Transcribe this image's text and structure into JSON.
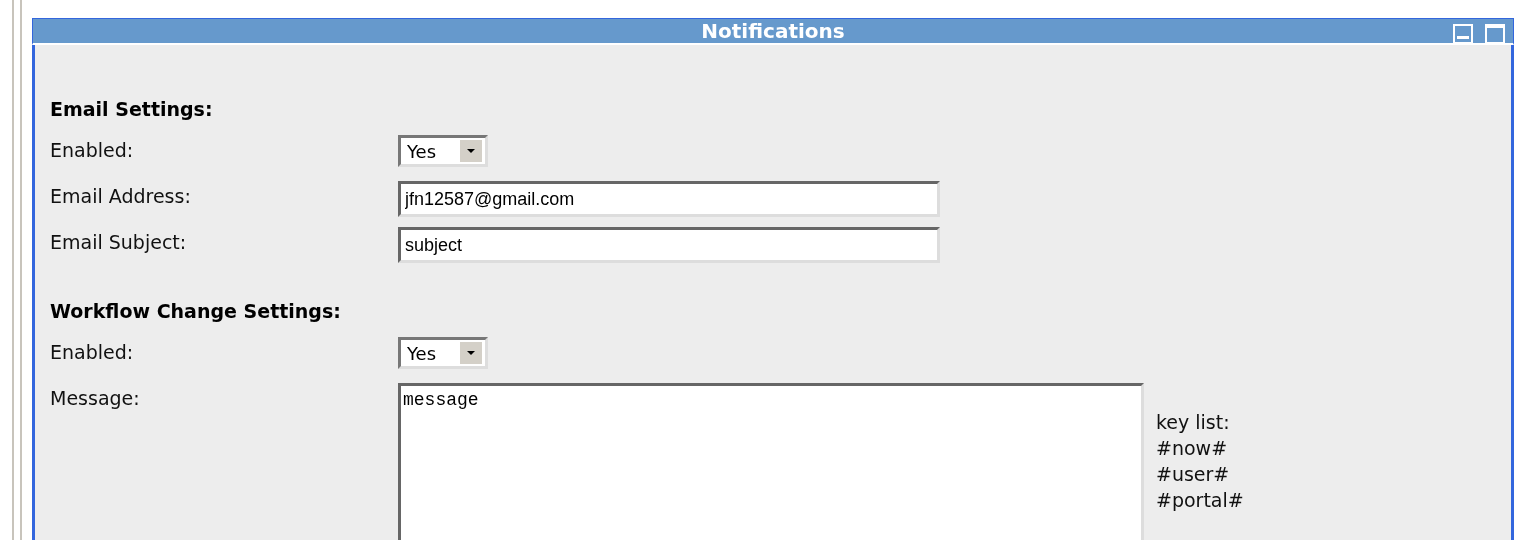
{
  "panel": {
    "title": "Notifications"
  },
  "sections": [
    {
      "heading": "Email Settings:",
      "fields": [
        {
          "kind": "select",
          "label": "Enabled:",
          "value": "Yes"
        },
        {
          "kind": "text",
          "label": "Email Address:",
          "value": "jfn12587@gmail.com"
        },
        {
          "kind": "text",
          "label": "Email Subject:",
          "value": "subject"
        }
      ]
    },
    {
      "heading": "Workflow Change Settings:",
      "fields": [
        {
          "kind": "select",
          "label": "Enabled:",
          "value": "Yes"
        },
        {
          "kind": "textarea",
          "label": "Message:",
          "value": "message",
          "key_list": [
            "key list:",
            "#now#",
            "#user#",
            "#portal#"
          ]
        }
      ]
    }
  ]
}
